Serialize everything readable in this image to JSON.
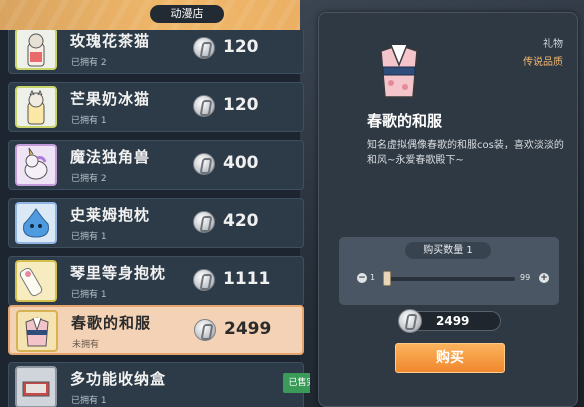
{
  "shop": {
    "title": "动漫店"
  },
  "items": [
    {
      "name": "玫瑰花茶猫",
      "owned": "已拥有 2",
      "price": "120",
      "icon": "rose-tea-cat-icon"
    },
    {
      "name": "芒果奶冰猫",
      "owned": "已拥有 1",
      "price": "120",
      "icon": "mango-milk-cat-icon"
    },
    {
      "name": "魔法独角兽",
      "owned": "已拥有 2",
      "price": "400",
      "icon": "unicorn-icon"
    },
    {
      "name": "史莱姆抱枕",
      "owned": "已拥有 1",
      "price": "420",
      "icon": "slime-pillow-icon"
    },
    {
      "name": "琴里等身抱枕",
      "owned": "已拥有 1",
      "price": "1111",
      "icon": "body-pillow-icon"
    },
    {
      "name": "春歌的和服",
      "owned": "未拥有",
      "price": "2499",
      "icon": "kimono-icon",
      "selected": true
    },
    {
      "name": "多功能收纳盒",
      "owned": "已拥有 1",
      "price": "",
      "sold": "已售完",
      "icon": "storage-box-icon"
    }
  ],
  "detail": {
    "type": "礼物",
    "rarity": "传说品质",
    "name": "春歌的和服",
    "desc": "知名虚拟偶像春歌的和服cos装，喜欢淡淡的和风~永爱春歌殿下~",
    "quantity_label": "购买数量 1",
    "min": "1",
    "max": "99",
    "minus": "−",
    "plus": "+",
    "quantity_fraction": 0.0,
    "total": "2499",
    "buy_label": "购买"
  },
  "colors": {
    "accent": "#f0882f",
    "rarity": "#f3b86f",
    "selected_bg": "#f3d2b6"
  }
}
